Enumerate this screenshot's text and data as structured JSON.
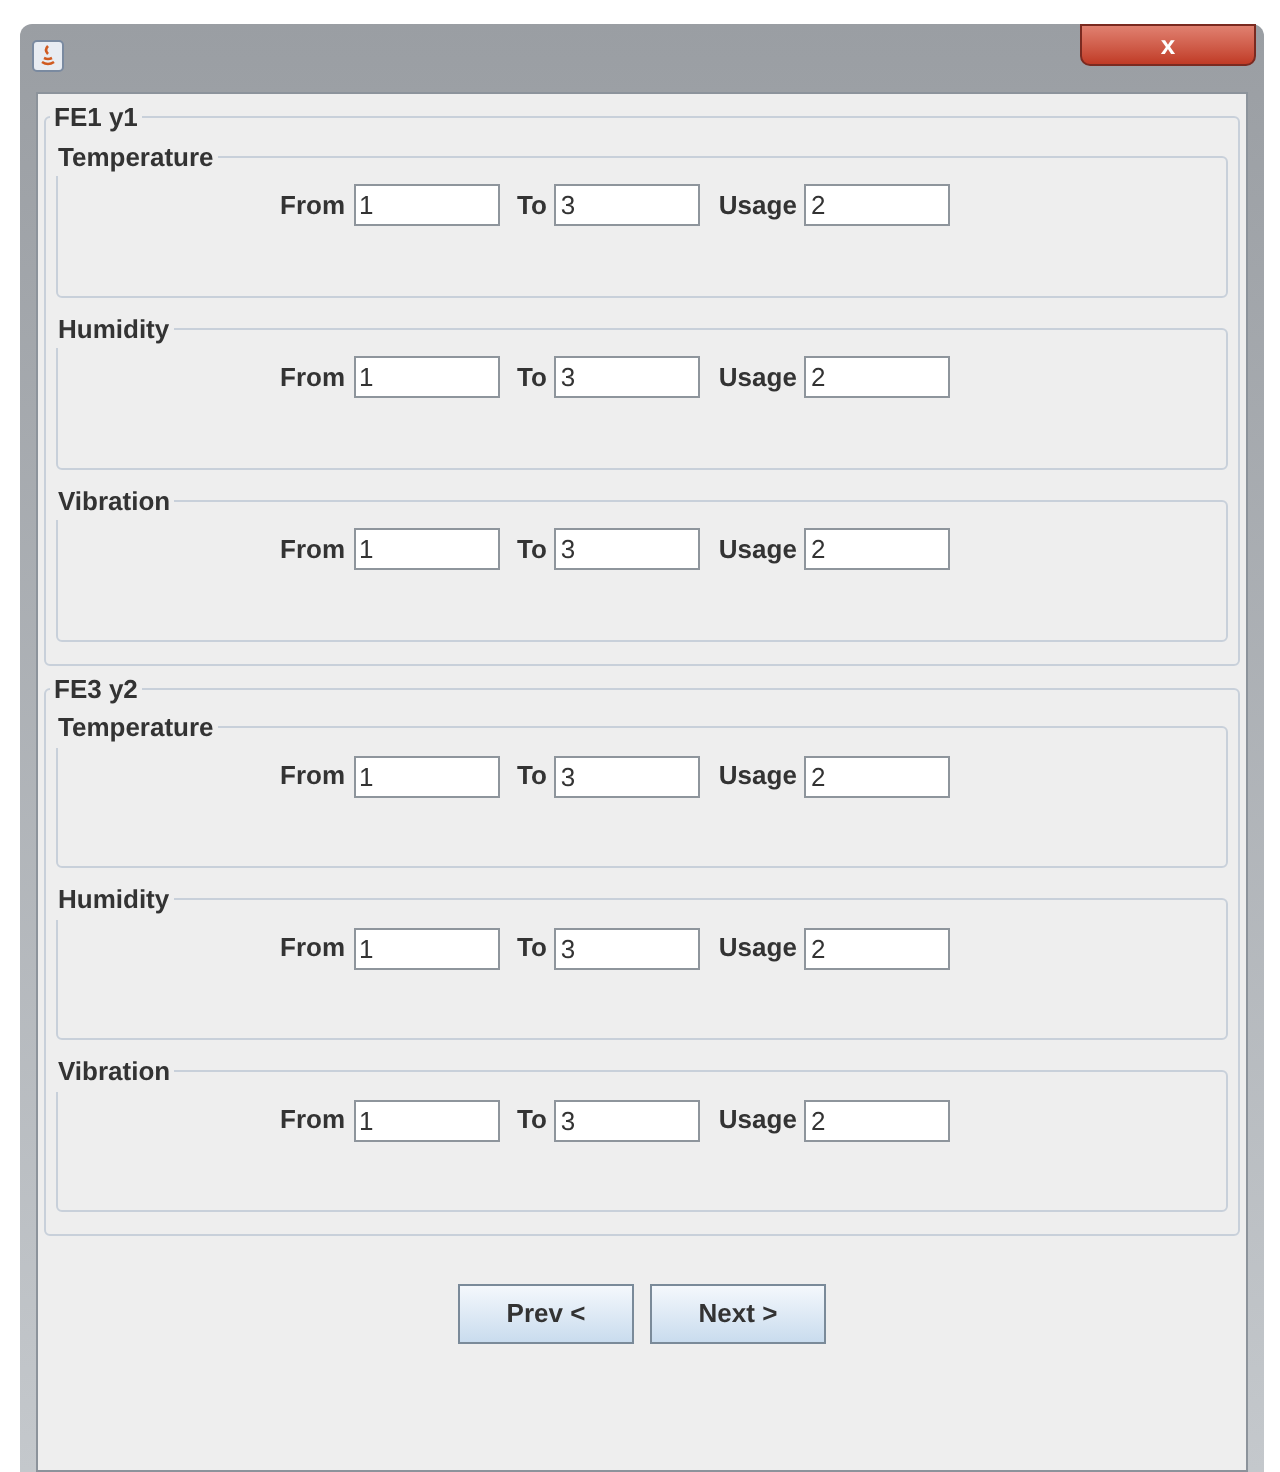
{
  "window": {
    "close_label": "x"
  },
  "groups": [
    {
      "title": "FE1 y1",
      "sections": [
        {
          "title": "Temperature",
          "fields": [
            {
              "label": "From",
              "value": "1"
            },
            {
              "label": "To",
              "value": "3"
            },
            {
              "label": "Usage",
              "value": "2"
            }
          ]
        },
        {
          "title": "Humidity",
          "fields": [
            {
              "label": "From",
              "value": "1"
            },
            {
              "label": "To",
              "value": "3"
            },
            {
              "label": "Usage",
              "value": "2"
            }
          ]
        },
        {
          "title": "Vibration",
          "fields": [
            {
              "label": "From",
              "value": "1"
            },
            {
              "label": "To",
              "value": "3"
            },
            {
              "label": "Usage",
              "value": "2"
            }
          ]
        }
      ]
    },
    {
      "title": "FE3 y2",
      "sections": [
        {
          "title": "Temperature",
          "fields": [
            {
              "label": "From",
              "value": "1"
            },
            {
              "label": "To",
              "value": "3"
            },
            {
              "label": "Usage",
              "value": "2"
            }
          ]
        },
        {
          "title": "Humidity",
          "fields": [
            {
              "label": "From",
              "value": "1"
            },
            {
              "label": "To",
              "value": "3"
            },
            {
              "label": "Usage",
              "value": "2"
            }
          ]
        },
        {
          "title": "Vibration",
          "fields": [
            {
              "label": "From",
              "value": "1"
            },
            {
              "label": "To",
              "value": "3"
            },
            {
              "label": "Usage",
              "value": "2"
            }
          ]
        }
      ]
    }
  ],
  "buttons": [
    "Prev <",
    "Next >"
  ]
}
